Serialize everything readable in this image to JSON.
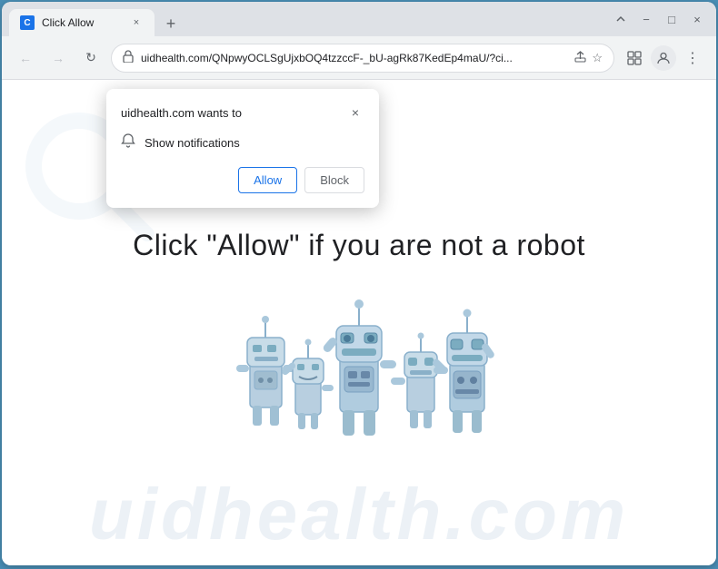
{
  "browser": {
    "tab": {
      "favicon": "C",
      "title": "Click Allow",
      "close_label": "×"
    },
    "new_tab_label": "+",
    "window_controls": {
      "minimize": "−",
      "maximize": "□",
      "close": "×"
    },
    "nav": {
      "back": "←",
      "forward": "→",
      "refresh": "↻"
    },
    "url": {
      "lock_icon": "🔒",
      "address": "uidhealth.com/QNpwyOCLSgUjxbOQ4tzzccF-_bU-agRk87KedEp4maU/?ci...",
      "share_icon": "⬆",
      "star_icon": "☆",
      "extension_icon": "□",
      "person_icon": "👤",
      "more_icon": "⋮"
    }
  },
  "popup": {
    "title": "uidhealth.com wants to",
    "close_label": "×",
    "notification_item": {
      "icon": "🔔",
      "text": "Show notifications"
    },
    "allow_button": "Allow",
    "block_button": "Block"
  },
  "page": {
    "headline": "Click \"Allow\"   if you are not   a robot"
  },
  "watermark": {
    "text": "uidhealth.com"
  }
}
